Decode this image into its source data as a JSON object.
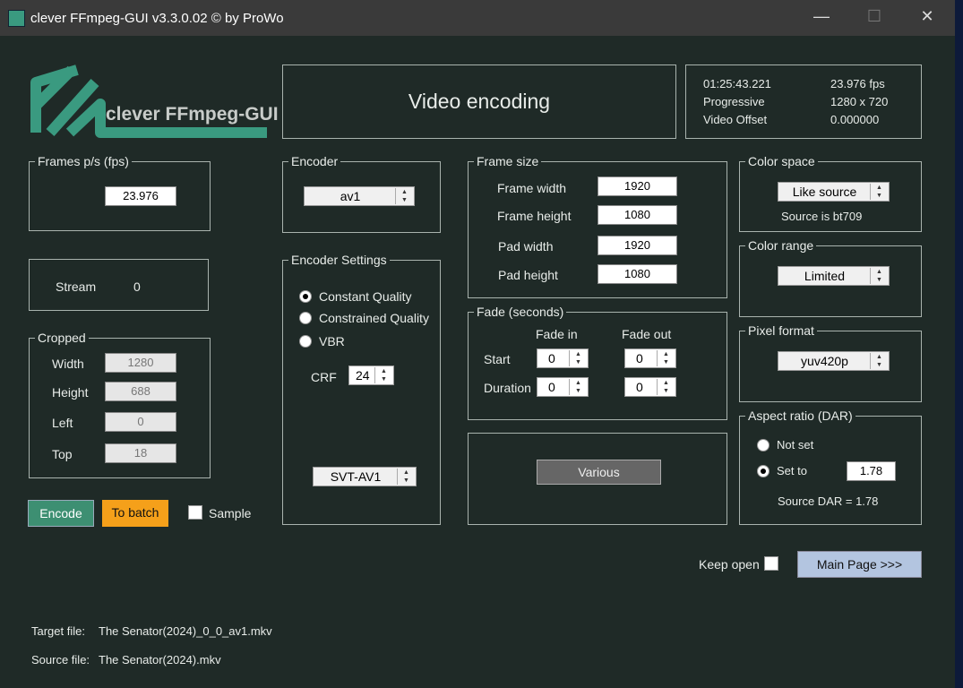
{
  "window": {
    "title": "clever FFmpeg-GUI v3.3.0.02   © by ProWo",
    "minimize": "—",
    "maximize": "☐",
    "close": "✕"
  },
  "logo": {
    "text": "clever FFmpeg-GUI"
  },
  "header": {
    "title": "Video encoding"
  },
  "info": {
    "duration": "01:25:43.221",
    "fps": "23.976 fps",
    "scan": "Progressive",
    "resolution": "1280 x 720",
    "offset_label": "Video Offset",
    "offset": "0.000000"
  },
  "fps_group": {
    "label": "Frames p/s (fps)",
    "value": "23.976"
  },
  "stream": {
    "label": "Stream",
    "value": "0"
  },
  "cropped": {
    "label": "Cropped",
    "fields": [
      {
        "label": "Width",
        "value": "1280"
      },
      {
        "label": "Height",
        "value": "688"
      },
      {
        "label": "Left",
        "value": "0"
      },
      {
        "label": "Top",
        "value": "18"
      }
    ]
  },
  "buttons": {
    "encode": "Encode",
    "batch": "To batch",
    "sample": "Sample",
    "various": "Various",
    "keep_open": "Keep open",
    "main_page": "Main Page >>>"
  },
  "encoder": {
    "label": "Encoder",
    "value": "av1"
  },
  "encoder_settings": {
    "label": "Encoder Settings",
    "modes": [
      "Constant Quality",
      "Constrained Quality",
      "VBR"
    ],
    "crf_label": "CRF",
    "crf": "24",
    "lib": "SVT-AV1"
  },
  "frame_size": {
    "label": "Frame size",
    "fields": [
      {
        "label": "Frame width",
        "value": "1920"
      },
      {
        "label": "Frame height",
        "value": "1080"
      },
      {
        "label": "Pad width",
        "value": "1920"
      },
      {
        "label": "Pad height",
        "value": "1080"
      }
    ]
  },
  "fade": {
    "label": "Fade (seconds)",
    "fade_in": "Fade in",
    "fade_out": "Fade out",
    "start": "Start",
    "duration": "Duration",
    "start_in": "0",
    "start_out": "0",
    "dur_in": "0",
    "dur_out": "0"
  },
  "color_space": {
    "label": "Color space",
    "value": "Like source",
    "note": "Source is bt709"
  },
  "color_range": {
    "label": "Color range",
    "value": "Limited"
  },
  "pixel_format": {
    "label": "Pixel format",
    "value": "yuv420p"
  },
  "aspect": {
    "label": "Aspect ratio (DAR)",
    "not_set": "Not set",
    "set_to": "Set to",
    "value": "1.78",
    "source": "Source DAR = 1.78"
  },
  "files": {
    "target_label": "Target file:",
    "target": "The Senator(2024)_0_0_av1.mkv",
    "source_label": "Source file:",
    "source": "The Senator(2024).mkv"
  }
}
